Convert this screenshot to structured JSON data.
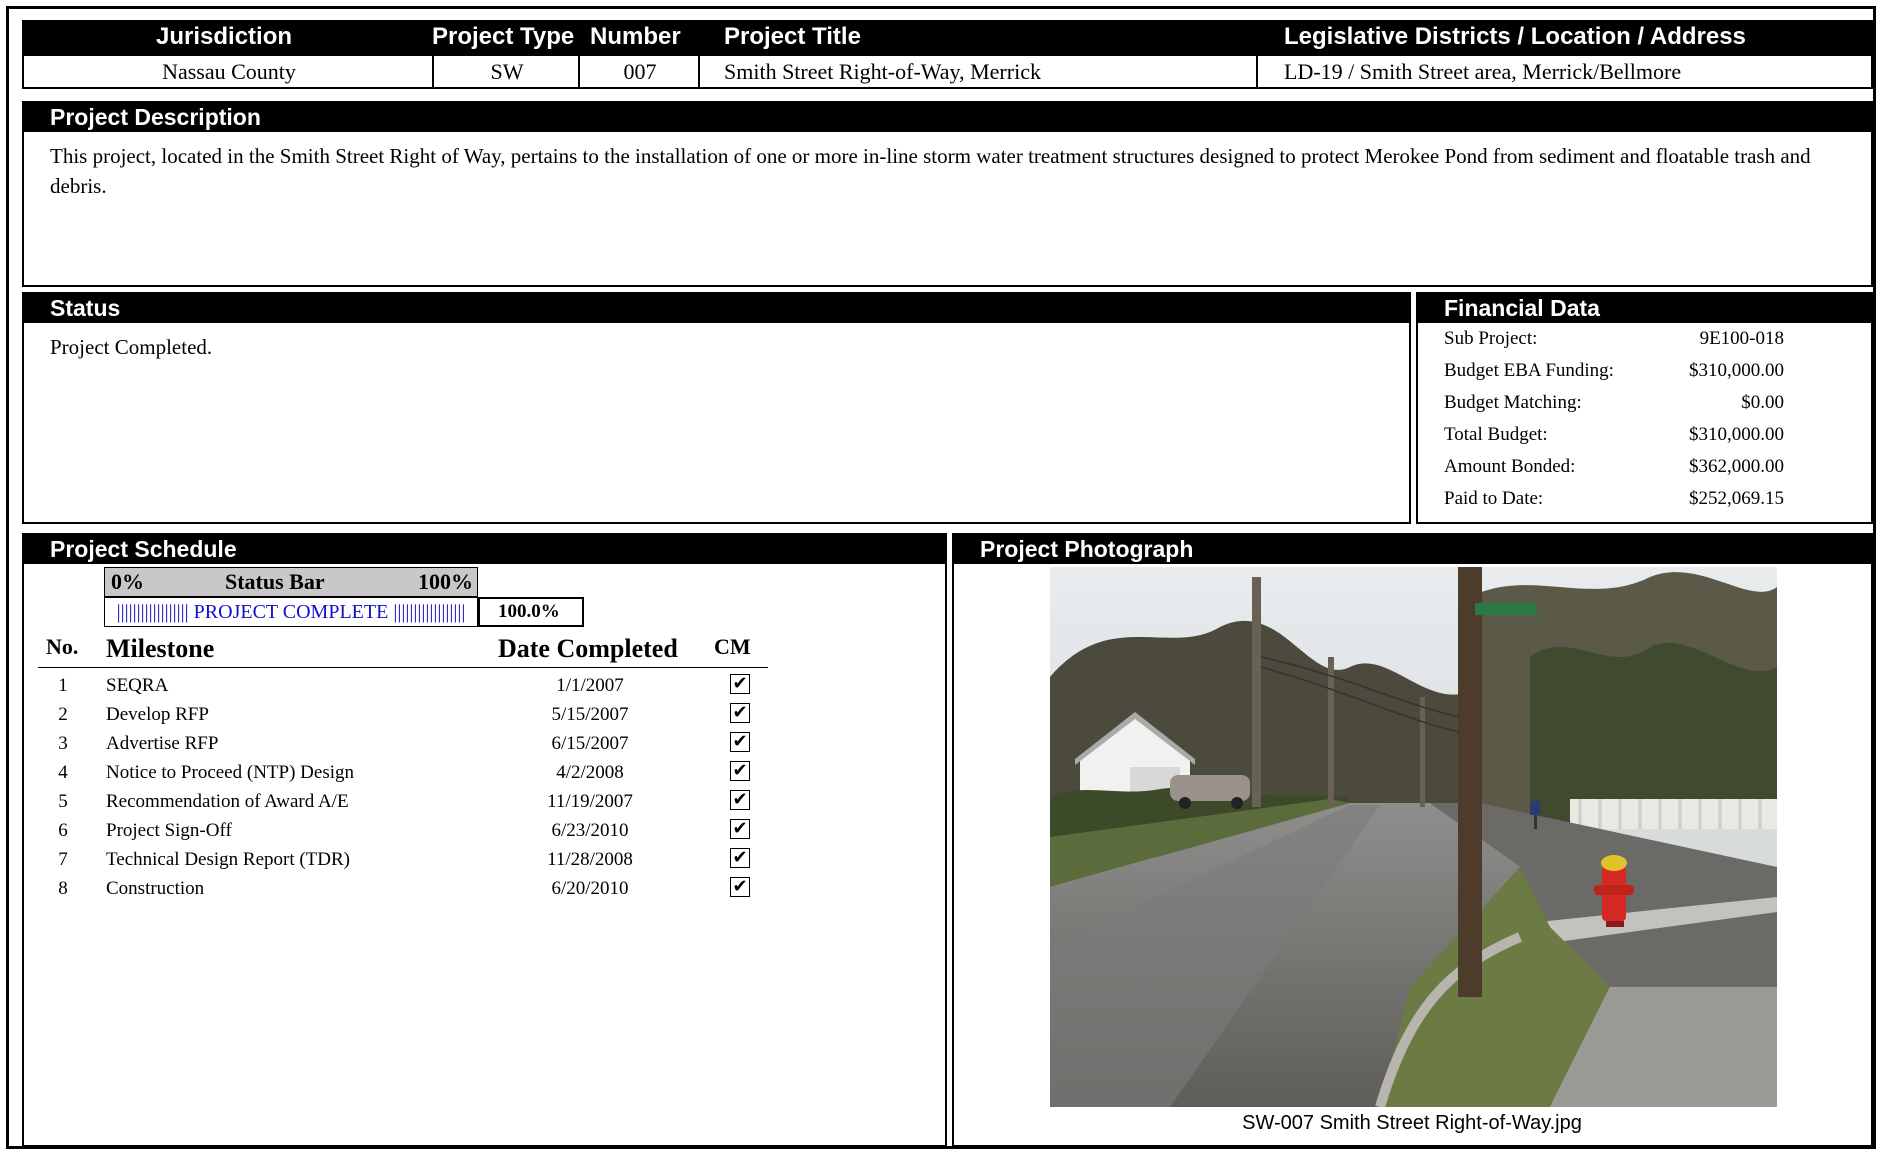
{
  "header": {
    "jurisdiction_label": "Jurisdiction",
    "project_type_label": "Project Type",
    "number_label": "Number",
    "project_title_label": "Project Title",
    "location_label": "Legislative Districts / Location / Address"
  },
  "project": {
    "jurisdiction": "Nassau County",
    "project_type": "SW",
    "number": "007",
    "title": "Smith Street Right-of-Way, Merrick",
    "location": "LD-19 / Smith Street area, Merrick/Bellmore"
  },
  "description": {
    "heading": "Project Description",
    "text": "This project, located in the Smith Street Right of Way, pertains to the installation of one or more in-line storm water treatment structures designed to protect Merokee Pond from sediment and floatable trash and debris."
  },
  "status": {
    "heading": "Status",
    "text": "Project Completed."
  },
  "financial": {
    "heading": "Financial Data",
    "rows": [
      {
        "label": "Sub Project:",
        "value": "9E100-018"
      },
      {
        "label": "Budget EBA Funding:",
        "value": "$310,000.00"
      },
      {
        "label": "Budget Matching:",
        "value": "$0.00"
      },
      {
        "label": "Total Budget:",
        "value": "$310,000.00"
      },
      {
        "label": "Amount Bonded:",
        "value": "$362,000.00"
      },
      {
        "label": "Paid to Date:",
        "value": "$252,069.15"
      }
    ]
  },
  "schedule": {
    "heading": "Project Schedule",
    "status_bar": {
      "left": "0%",
      "label": "Status Bar",
      "right": "100%"
    },
    "progress_text": "|||||||||||||||||| PROJECT COMPLETE ||||||||||||||||||",
    "progress_fraction": 1.0,
    "percent": "100.0%",
    "columns": {
      "no": "No.",
      "milestone": "Milestone",
      "date": "Date Completed",
      "cm": "CM"
    },
    "milestones": [
      {
        "no": "1",
        "name": "SEQRA",
        "date": "1/1/2007",
        "cm": "✔"
      },
      {
        "no": "2",
        "name": "Develop RFP",
        "date": "5/15/2007",
        "cm": "✔"
      },
      {
        "no": "3",
        "name": "Advertise RFP",
        "date": "6/15/2007",
        "cm": "✔"
      },
      {
        "no": "4",
        "name": "Notice to Proceed (NTP) Design",
        "date": "4/2/2008",
        "cm": "✔"
      },
      {
        "no": "5",
        "name": "Recommendation of Award A/E",
        "date": "11/19/2007",
        "cm": "✔"
      },
      {
        "no": "6",
        "name": "Project Sign-Off",
        "date": "6/23/2010",
        "cm": "✔"
      },
      {
        "no": "7",
        "name": "Technical Design Report (TDR)",
        "date": "11/28/2008",
        "cm": "✔"
      },
      {
        "no": "8",
        "name": "Construction",
        "date": "6/20/2010",
        "cm": "✔"
      }
    ]
  },
  "photograph": {
    "heading": "Project Photograph",
    "caption": "SW-007 Smith Street Right-of-Way.jpg"
  }
}
